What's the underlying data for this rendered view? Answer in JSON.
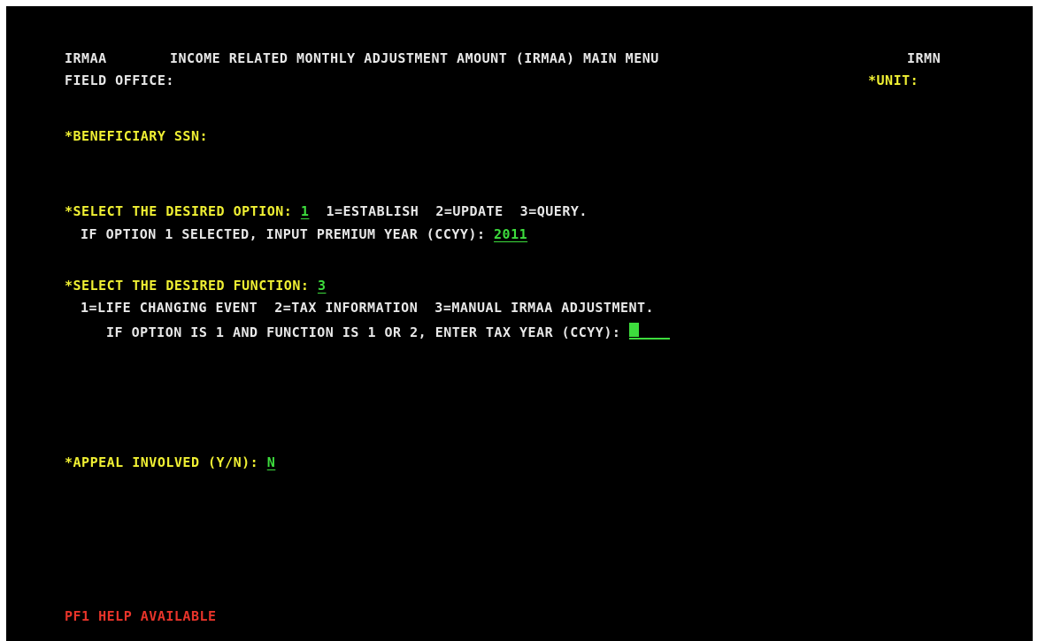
{
  "header": {
    "screen_id": "IRMAA",
    "title": "INCOME RELATED MONTHLY ADJUSTMENT AMOUNT (IRMAA) MAIN MENU",
    "screen_code": "IRMN"
  },
  "field_office": {
    "label": "FIELD OFFICE:"
  },
  "unit": {
    "label": "*UNIT:"
  },
  "beneficiary": {
    "label": "*BENEFICIARY SSN:"
  },
  "option": {
    "label": "*SELECT THE DESIRED OPTION:",
    "value": "1",
    "choices": "1=ESTABLISH  2=UPDATE  3=QUERY."
  },
  "premium_year": {
    "label": "IF OPTION 1 SELECTED, INPUT PREMIUM YEAR (CCYY):",
    "value": "2011"
  },
  "function": {
    "label": "*SELECT THE DESIRED FUNCTION:",
    "value": "3",
    "choices": "1=LIFE CHANGING EVENT  2=TAX INFORMATION  3=MANUAL IRMAA ADJUSTMENT."
  },
  "tax_year": {
    "label": "IF OPTION IS 1 AND FUNCTION IS 1 OR 2, ENTER TAX YEAR (CCYY):",
    "value": ""
  },
  "appeal": {
    "label": "*APPEAL INVOLVED (Y/N):",
    "value": "N"
  },
  "footer": {
    "help": "PF1 HELP AVAILABLE"
  },
  "colors": {
    "background": "#000000",
    "text": "#e8e8e8",
    "prompt": "#f0f033",
    "input": "#3ddc3d",
    "help": "#e8342a"
  }
}
